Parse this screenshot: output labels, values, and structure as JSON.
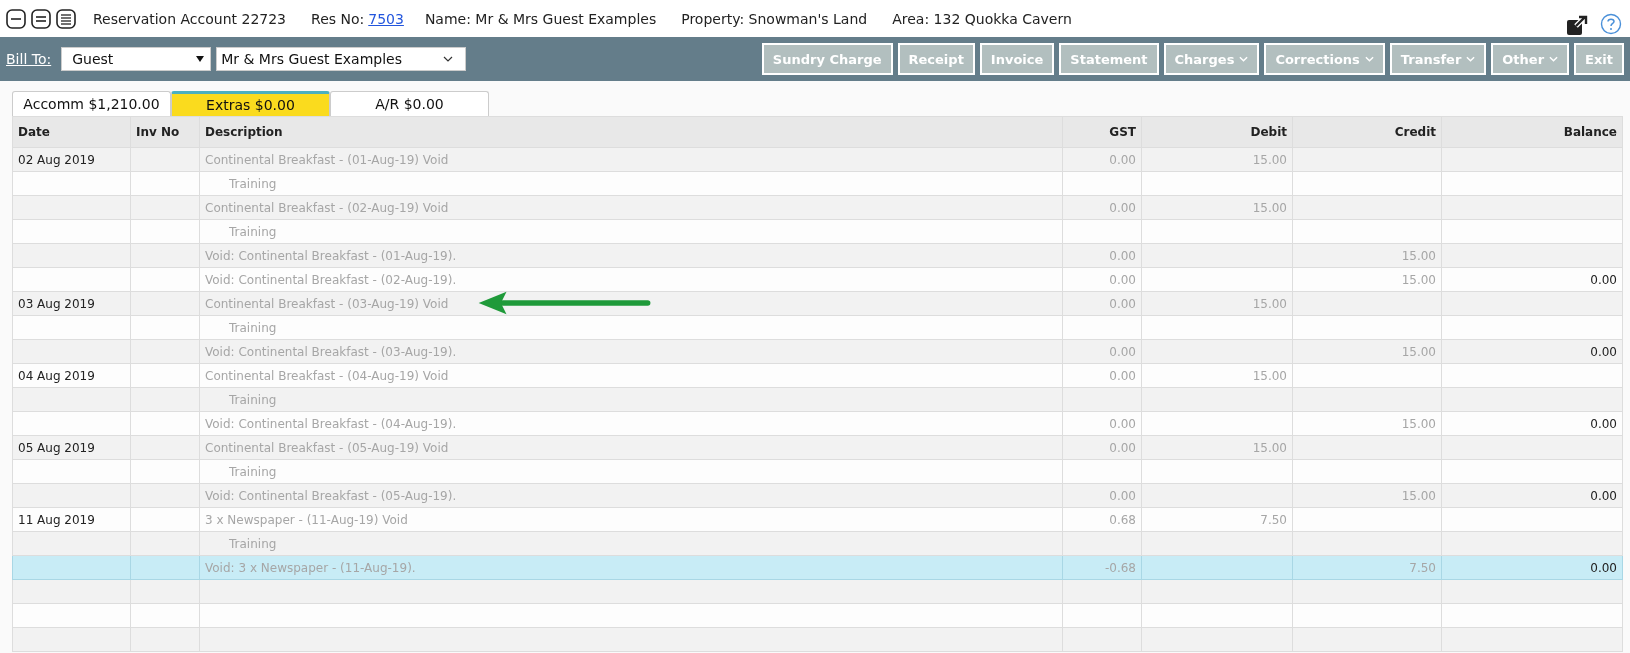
{
  "header": {
    "title": "Reservation Account 22723",
    "fields": [
      {
        "label": "Res No:",
        "value": "7503",
        "link": true
      },
      {
        "label": "Name:",
        "value": "Mr & Mrs Guest Examples",
        "link": false
      },
      {
        "label": "Property:",
        "value": "Snowman's Land",
        "link": false
      },
      {
        "label": "Area:",
        "value": "132 Quokka Cavern",
        "link": false
      }
    ]
  },
  "bill_to": {
    "label": "Bill To:",
    "type": "Guest",
    "name": "Mr & Mrs Guest Examples"
  },
  "buttons": [
    {
      "label": "Sundry Charge",
      "menu": false
    },
    {
      "label": "Receipt",
      "menu": false
    },
    {
      "label": "Invoice",
      "menu": false
    },
    {
      "label": "Statement",
      "menu": false
    },
    {
      "label": "Charges",
      "menu": true
    },
    {
      "label": "Corrections",
      "menu": true
    },
    {
      "label": "Transfer",
      "menu": true
    },
    {
      "label": "Other",
      "menu": true
    },
    {
      "label": "Exit",
      "menu": false
    }
  ],
  "tabs": [
    {
      "label": "Accomm $1,210.00",
      "selected": false
    },
    {
      "label": "Extras $0.00",
      "selected": true
    },
    {
      "label": "A/R $0.00",
      "selected": false
    }
  ],
  "table": {
    "columns": [
      "Date",
      "Inv No",
      "Description",
      "GST",
      "Debit",
      "Credit",
      "Balance"
    ],
    "rows": [
      {
        "kind": "entry",
        "date": "02 Aug 2019",
        "description": "Continental Breakfast - (01-Aug-19) Void",
        "gst": "0.00",
        "debit": "15.00",
        "voided": true,
        "selected": false
      },
      {
        "kind": "note",
        "description": "Training",
        "voided": true,
        "selected": false
      },
      {
        "kind": "entry",
        "description": "Continental Breakfast - (02-Aug-19) Void",
        "gst": "0.00",
        "debit": "15.00",
        "voided": true,
        "selected": false
      },
      {
        "kind": "note",
        "description": "Training",
        "voided": true,
        "selected": false
      },
      {
        "kind": "entry",
        "description": "Void: Continental Breakfast - (01-Aug-19).",
        "gst": "0.00",
        "credit": "15.00",
        "voided": true,
        "selected": false
      },
      {
        "kind": "entry",
        "description": "Void: Continental Breakfast - (02-Aug-19).",
        "gst": "0.00",
        "credit": "15.00",
        "balance": "0.00",
        "voided": true,
        "selected": false
      },
      {
        "kind": "entry",
        "date": "03 Aug 2019",
        "description": "Continental Breakfast - (03-Aug-19) Void",
        "gst": "0.00",
        "debit": "15.00",
        "voided": true,
        "selected": false,
        "pointer": true
      },
      {
        "kind": "note",
        "description": "Training",
        "voided": true,
        "selected": false
      },
      {
        "kind": "entry",
        "description": "Void: Continental Breakfast - (03-Aug-19).",
        "gst": "0.00",
        "credit": "15.00",
        "balance": "0.00",
        "voided": true,
        "selected": false
      },
      {
        "kind": "entry",
        "date": "04 Aug 2019",
        "description": "Continental Breakfast - (04-Aug-19) Void",
        "gst": "0.00",
        "debit": "15.00",
        "voided": true,
        "selected": false
      },
      {
        "kind": "note",
        "description": "Training",
        "voided": true,
        "selected": false
      },
      {
        "kind": "entry",
        "description": "Void: Continental Breakfast - (04-Aug-19).",
        "gst": "0.00",
        "credit": "15.00",
        "balance": "0.00",
        "voided": true,
        "selected": false
      },
      {
        "kind": "entry",
        "date": "05 Aug 2019",
        "description": "Continental Breakfast - (05-Aug-19) Void",
        "gst": "0.00",
        "debit": "15.00",
        "voided": true,
        "selected": false
      },
      {
        "kind": "note",
        "description": "Training",
        "voided": true,
        "selected": false
      },
      {
        "kind": "entry",
        "description": "Void: Continental Breakfast - (05-Aug-19).",
        "gst": "0.00",
        "credit": "15.00",
        "balance": "0.00",
        "voided": true,
        "selected": false
      },
      {
        "kind": "entry",
        "date": "11 Aug 2019",
        "description": "3 x Newspaper - (11-Aug-19) Void",
        "gst": "0.68",
        "debit": "7.50",
        "voided": true,
        "selected": false
      },
      {
        "kind": "note",
        "description": "Training",
        "voided": true,
        "selected": false
      },
      {
        "kind": "entry",
        "description": "Void: 3 x Newspaper - (11-Aug-19).",
        "gst": "-0.68",
        "credit": "7.50",
        "balance": "0.00",
        "voided": true,
        "selected": true
      },
      {
        "selected": false
      },
      {
        "selected": false
      },
      {
        "selected": false
      }
    ]
  }
}
